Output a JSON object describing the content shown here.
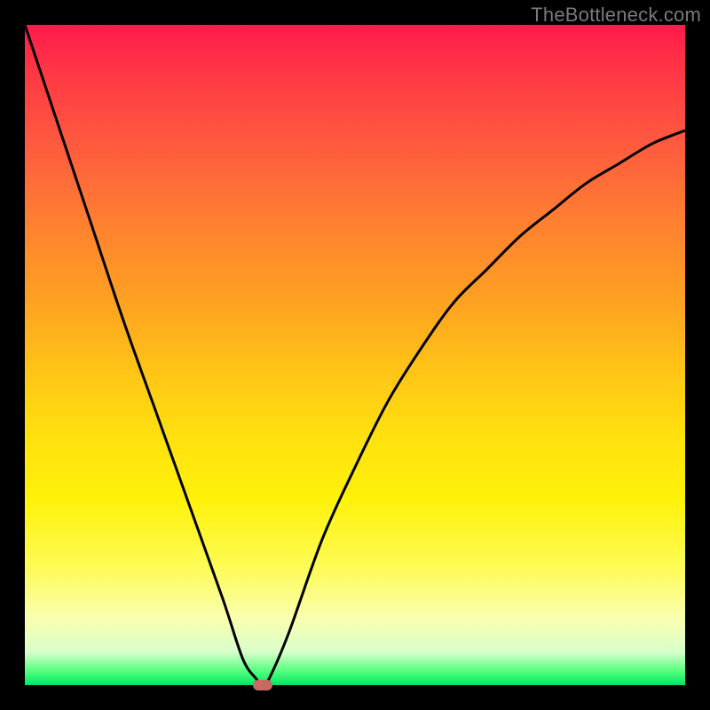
{
  "watermark": "TheBottleneck.com",
  "chart_data": {
    "type": "line",
    "title": "",
    "xlabel": "",
    "ylabel": "",
    "xlim": [
      0,
      100
    ],
    "ylim": [
      0,
      100
    ],
    "grid": false,
    "legend": false,
    "background_gradient": {
      "top_color": "#ff1a4b",
      "mid_color": "#ffe00f",
      "bottom_color": "#00e56a"
    },
    "series": [
      {
        "name": "bottleneck-curve",
        "stroke": "#000000",
        "x": [
          0,
          5,
          10,
          15,
          20,
          25,
          30,
          33,
          35,
          36,
          37,
          40,
          45,
          50,
          55,
          60,
          65,
          70,
          75,
          80,
          85,
          90,
          95,
          100
        ],
        "values": [
          100,
          85,
          70,
          55,
          41,
          27,
          13,
          4,
          1,
          0,
          1,
          8,
          22,
          33,
          43,
          51,
          58,
          63,
          68,
          72,
          76,
          79,
          82,
          84
        ]
      }
    ],
    "marker": {
      "name": "optimum-point",
      "x": 36,
      "y": 0,
      "color": "#c96a62",
      "shape": "rounded-rect"
    }
  }
}
